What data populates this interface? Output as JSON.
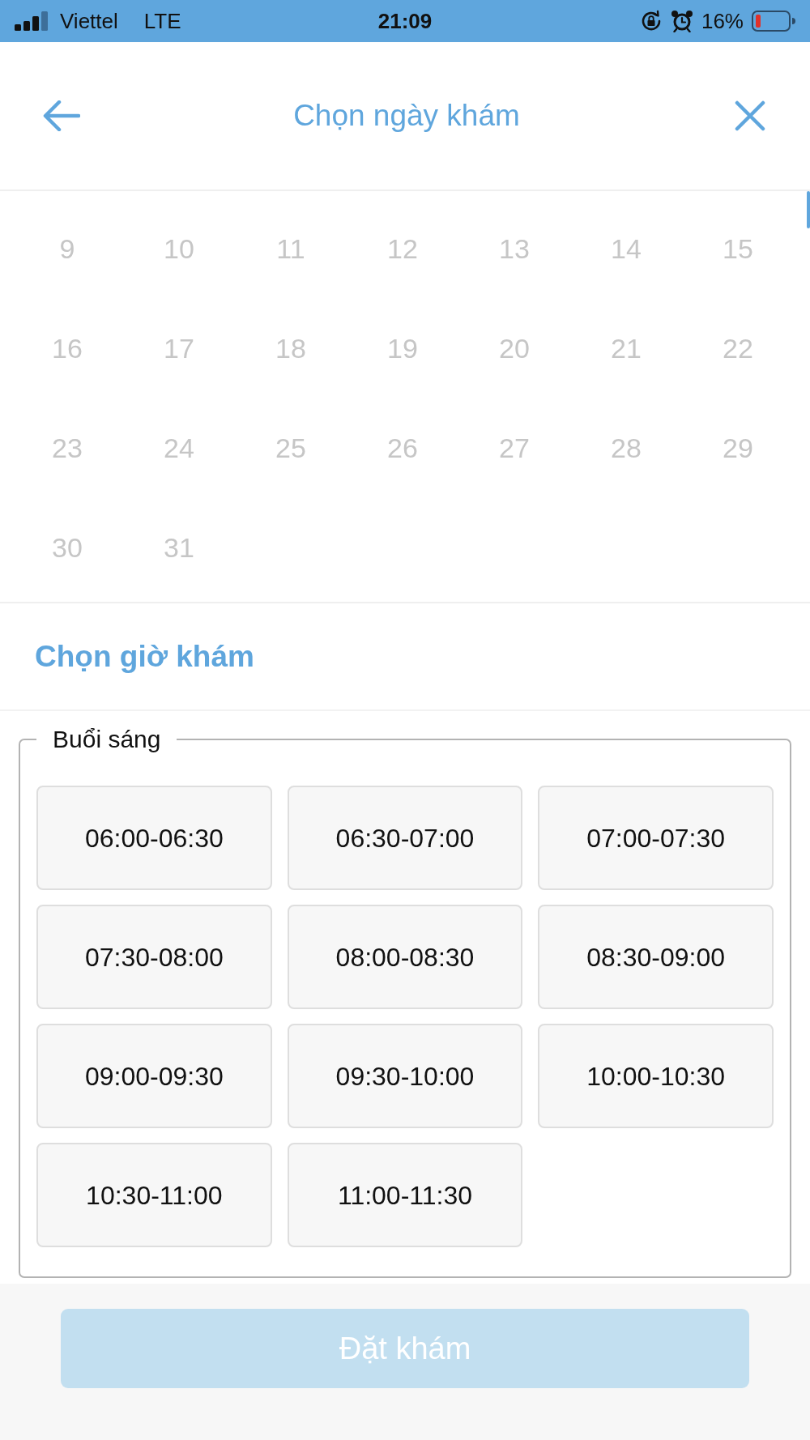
{
  "status_bar": {
    "carrier": "Viettel",
    "network": "LTE",
    "time": "21:09",
    "battery": "16%"
  },
  "header": {
    "title": "Chọn ngày khám"
  },
  "calendar": {
    "days": [
      {
        "label": "9",
        "disabled": true
      },
      {
        "label": "10",
        "disabled": true
      },
      {
        "label": "11",
        "disabled": true
      },
      {
        "label": "12",
        "disabled": true
      },
      {
        "label": "13",
        "disabled": true
      },
      {
        "label": "14",
        "disabled": true
      },
      {
        "label": "15",
        "disabled": true
      },
      {
        "label": "16",
        "disabled": true
      },
      {
        "label": "17",
        "disabled": true
      },
      {
        "label": "18",
        "disabled": true
      },
      {
        "label": "19",
        "disabled": true
      },
      {
        "label": "20",
        "disabled": true
      },
      {
        "label": "21",
        "disabled": true
      },
      {
        "label": "22",
        "disabled": true
      },
      {
        "label": "23",
        "disabled": true
      },
      {
        "label": "24",
        "disabled": true
      },
      {
        "label": "25",
        "disabled": true
      },
      {
        "label": "26",
        "disabled": true
      },
      {
        "label": "27",
        "disabled": true
      },
      {
        "label": "28",
        "disabled": true
      },
      {
        "label": "29",
        "disabled": true
      },
      {
        "label": "30",
        "disabled": true
      },
      {
        "label": "31",
        "disabled": true
      }
    ]
  },
  "time_section": {
    "title": "Chọn giờ khám",
    "groups": [
      {
        "label": "Buổi sáng",
        "slots": [
          {
            "label": "06:00-06:30",
            "selected": false
          },
          {
            "label": "06:30-07:00",
            "selected": false
          },
          {
            "label": "07:00-07:30",
            "selected": false
          },
          {
            "label": "07:30-08:00",
            "selected": false
          },
          {
            "label": "08:00-08:30",
            "selected": false
          },
          {
            "label": "08:30-09:00",
            "selected": false
          },
          {
            "label": "09:00-09:30",
            "selected": false
          },
          {
            "label": "09:30-10:00",
            "selected": false
          },
          {
            "label": "10:00-10:30",
            "selected": false
          },
          {
            "label": "10:30-11:00",
            "selected": false
          },
          {
            "label": "11:00-11:30",
            "selected": false
          }
        ]
      }
    ]
  },
  "footer": {
    "button": {
      "label": "Đặt khám",
      "disabled": true
    }
  }
}
